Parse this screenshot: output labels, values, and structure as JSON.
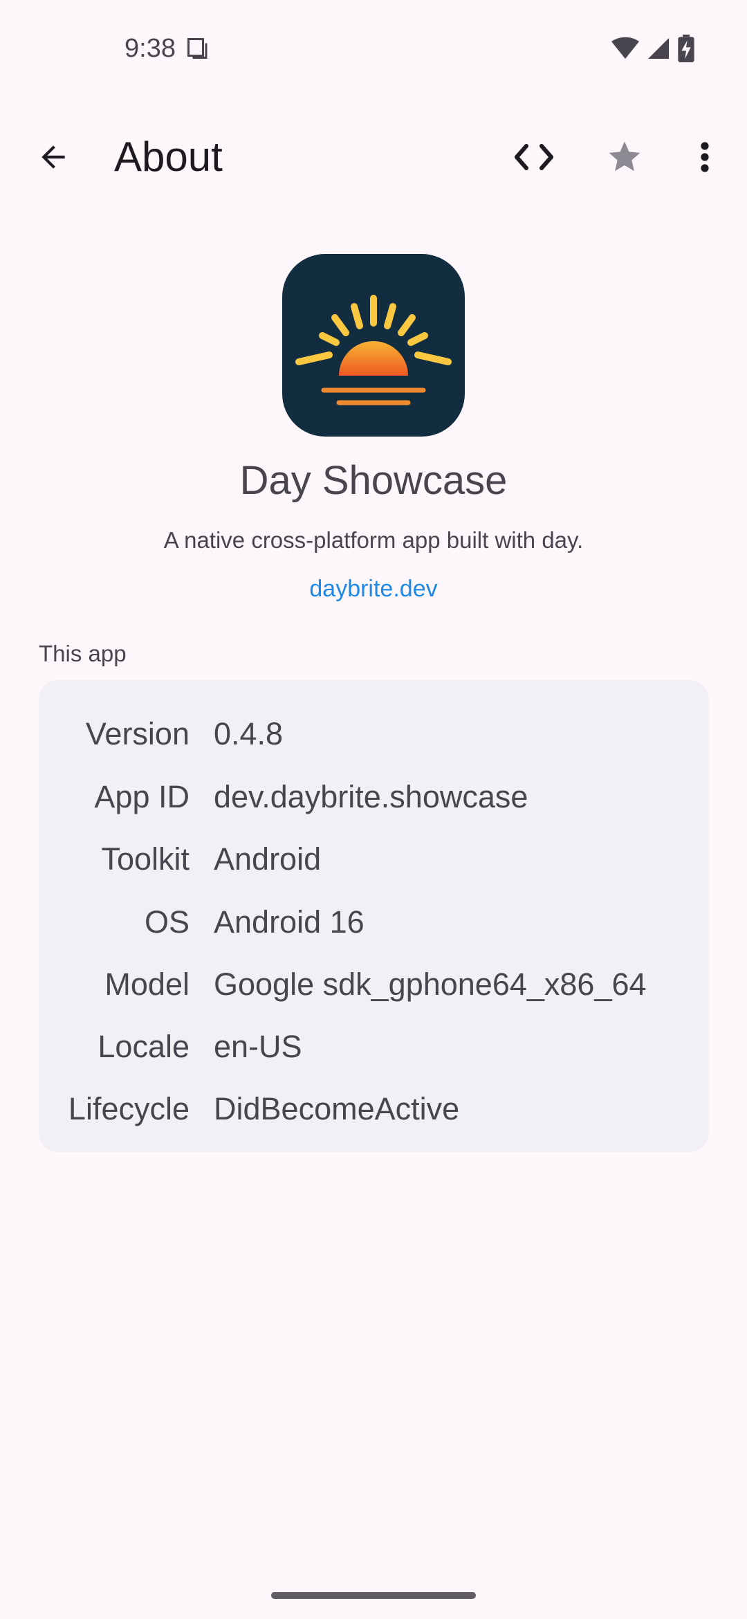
{
  "status_bar": {
    "time": "9:38",
    "icons": [
      "document-icon",
      "wifi-icon",
      "cellular-icon",
      "battery-charging-icon"
    ]
  },
  "app_bar": {
    "title": "About",
    "actions": [
      "arrow-back-icon",
      "code-icon",
      "star-icon",
      "more-vert-icon"
    ]
  },
  "app": {
    "icon": "sunrise-logo",
    "name": "Day Showcase",
    "description": "A native cross-platform app built with day.",
    "link": "daybrite.dev"
  },
  "section": {
    "label": "This app",
    "rows": [
      {
        "key": "Version",
        "value": "0.4.8"
      },
      {
        "key": "App ID",
        "value": "dev.daybrite.showcase"
      },
      {
        "key": "Toolkit",
        "value": "Android"
      },
      {
        "key": "OS",
        "value": "Android 16"
      },
      {
        "key": "Model",
        "value": "Google sdk_gphone64_x86_64"
      },
      {
        "key": "Locale",
        "value": "en-US"
      },
      {
        "key": "Lifecycle",
        "value": "DidBecomeActive"
      }
    ]
  },
  "colors": {
    "background": "#FDF7FB",
    "card": "#F2EFF5",
    "link": "#1E88E5",
    "icon_bg": "#132D40",
    "sun_yellow": "#F9C840",
    "sun_orange": "#F08A2E"
  }
}
